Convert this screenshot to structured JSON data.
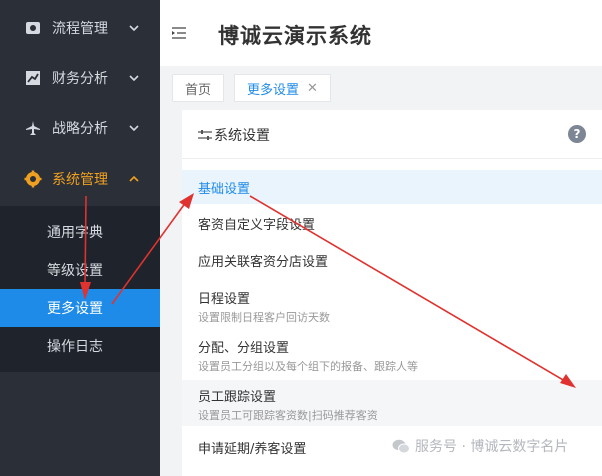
{
  "app": {
    "title": "博诚云演示系统"
  },
  "sidebar": {
    "items": [
      {
        "label": "流程管理",
        "icon": "workflow-icon",
        "state": "collapsed"
      },
      {
        "label": "财务分析",
        "icon": "chart-icon",
        "state": "collapsed"
      },
      {
        "label": "战略分析",
        "icon": "plane-icon",
        "state": "collapsed"
      },
      {
        "label": "系统管理",
        "icon": "gear-icon",
        "state": "expanded"
      }
    ],
    "submenu": [
      {
        "label": "通用字典"
      },
      {
        "label": "等级设置"
      },
      {
        "label": "更多设置",
        "active": true
      },
      {
        "label": "操作日志"
      }
    ]
  },
  "tabs": [
    {
      "label": "首页"
    },
    {
      "label": "更多设置",
      "active": true,
      "close": "✕"
    }
  ],
  "panel": {
    "title": "系统设置",
    "help": "?",
    "items": [
      {
        "label": "基础设置"
      },
      {
        "label": "客资自定义字段设置"
      },
      {
        "label": "应用关联客资分店设置"
      },
      {
        "label": "日程设置",
        "desc": "设置限制日程客户回访天数"
      },
      {
        "label": "分配、分组设置",
        "desc": "设置员工分组以及每个组下的报备、跟踪人等"
      },
      {
        "label": "员工跟踪设置",
        "desc": "设置员工可跟踪客资数|扫码推荐客资"
      },
      {
        "label": "申请延期/养客设置"
      }
    ]
  },
  "watermark": {
    "text": "服务号 · 博诚云数字名片"
  },
  "colors": {
    "sidebar_bg": "#2b2f38",
    "accent": "#1f8be8",
    "highlight": "#f0a020",
    "arrow": "#e0322e"
  }
}
